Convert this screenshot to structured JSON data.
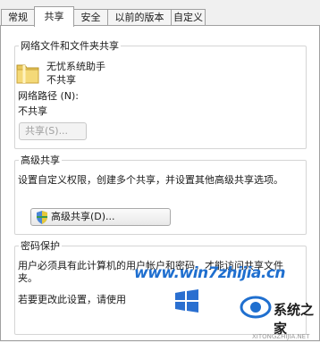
{
  "tabs": [
    "常规",
    "共享",
    "安全",
    "以前的版本",
    "自定义"
  ],
  "active_tab": "共享",
  "network_share": {
    "legend": "网络文件和文件夹共享",
    "folder_name": "无忧系统助手",
    "folder_status": "不共享",
    "path_label": "网络路径 (N):",
    "path_value": "不共享",
    "share_button": "共享(S)..."
  },
  "advanced": {
    "legend": "高级共享",
    "description": "设置自定义权限，创建多个共享，并设置其他高级共享选项。",
    "button": "高级共享(D)..."
  },
  "password": {
    "legend": "密码保护",
    "description": "用户必须具有此计算机的用户帐户和密码，才能访问共享文件夹。",
    "change_text": "若要更改此设置，请使用"
  },
  "watermark": {
    "site": "www.win7zhijia.cn",
    "brand": "系统之家",
    "url_small": "XITONGZHIJIA.NET"
  },
  "colors": {
    "link": "#1f6fcf",
    "tab_border": "#a0a0a0"
  }
}
